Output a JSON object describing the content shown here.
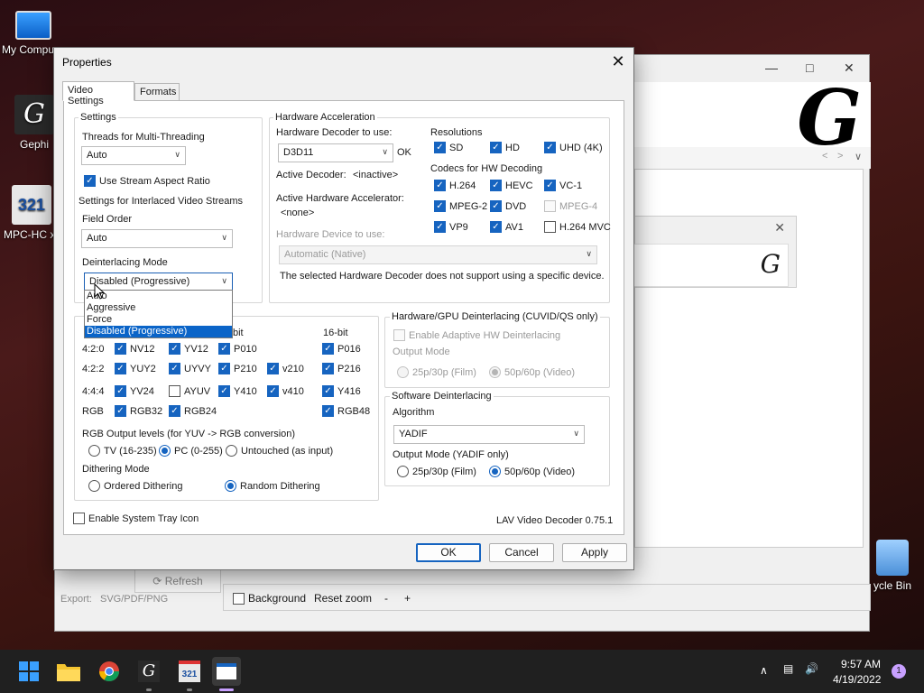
{
  "desktop": {
    "icons": [
      {
        "label": "My Compu"
      },
      {
        "label": "Gephi"
      },
      {
        "label": "MPC-HC x"
      },
      {
        "label": "ycle Bin"
      }
    ]
  },
  "gephi": {
    "refresh_label": "Refresh",
    "export_label": "Export:",
    "export_formats": "SVG/PDF/PNG",
    "background_label": "Background",
    "reset_zoom_label": "Reset zoom",
    "minus": "-",
    "plus": "+"
  },
  "dialog": {
    "title": "Properties",
    "tabs": [
      {
        "label": "Video Settings",
        "active": true
      },
      {
        "label": "Formats",
        "active": false
      }
    ],
    "settings": {
      "group_title": "Settings",
      "threads_label": "Threads for Multi-Threading",
      "threads_value": "Auto",
      "stream_aspect_label": "Use Stream Aspect Ratio",
      "stream_aspect_checked": true,
      "interlaced_label": "Settings for Interlaced Video Streams",
      "field_order_label": "Field Order",
      "field_order_value": "Auto",
      "deint_mode_label": "Deinterlacing Mode",
      "deint_mode_value": "Disabled (Progressive)",
      "deint_options": [
        "Auto",
        "Aggressive",
        "Force",
        "Disabled (Progressive)"
      ]
    },
    "hwaccel": {
      "group_title": "Hardware Acceleration",
      "decoder_label": "Hardware Decoder to use:",
      "decoder_value": "D3D11",
      "decoder_status": "OK",
      "active_decoder_label": "Active Decoder:",
      "active_decoder_value": "<inactive>",
      "active_accel_label": "Active Hardware Accelerator:",
      "active_accel_value": "<none>",
      "device_label": "Hardware Device to use:",
      "device_value": "Automatic (Native)",
      "device_note": "The selected Hardware Decoder does not support using a specific device.",
      "resolutions_label": "Resolutions",
      "resolutions": [
        {
          "label": "SD",
          "checked": true,
          "enabled": true
        },
        {
          "label": "HD",
          "checked": true,
          "enabled": true
        },
        {
          "label": "UHD (4K)",
          "checked": true,
          "enabled": true
        }
      ],
      "codecs_label": "Codecs for HW Decoding",
      "codecs": [
        {
          "label": "H.264",
          "checked": true,
          "enabled": true
        },
        {
          "label": "HEVC",
          "checked": true,
          "enabled": true
        },
        {
          "label": "VC-1",
          "checked": true,
          "enabled": true
        },
        {
          "label": "MPEG-2",
          "checked": true,
          "enabled": true
        },
        {
          "label": "DVD",
          "checked": true,
          "enabled": true
        },
        {
          "label": "MPEG-4",
          "checked": false,
          "enabled": false
        },
        {
          "label": "VP9",
          "checked": true,
          "enabled": true
        },
        {
          "label": "AV1",
          "checked": true,
          "enabled": true
        },
        {
          "label": "H.264 MVC",
          "checked": false,
          "enabled": true
        }
      ]
    },
    "formats": {
      "col_headers": [
        "bit",
        "16-bit"
      ],
      "rows": [
        {
          "label": "4:2:0",
          "items": [
            {
              "label": "NV12",
              "checked": true
            },
            {
              "label": "YV12",
              "checked": true
            },
            {
              "label": "P010",
              "checked": true
            },
            {
              "label": "P016",
              "checked": true
            }
          ]
        },
        {
          "label": "4:2:2",
          "items": [
            {
              "label": "YUY2",
              "checked": true
            },
            {
              "label": "UYVY",
              "checked": true
            },
            {
              "label": "P210",
              "checked": true
            },
            {
              "label": "v210",
              "checked": true
            },
            {
              "label": "P216",
              "checked": true
            }
          ]
        },
        {
          "label": "4:4:4",
          "items": [
            {
              "label": "YV24",
              "checked": true
            },
            {
              "label": "AYUV",
              "checked": false
            },
            {
              "label": "Y410",
              "checked": true
            },
            {
              "label": "v410",
              "checked": true
            },
            {
              "label": "Y416",
              "checked": true
            }
          ]
        },
        {
          "label": "RGB",
          "items": [
            {
              "label": "RGB32",
              "checked": true
            },
            {
              "label": "RGB24",
              "checked": true
            },
            {
              "label": "RGB48",
              "checked": true
            }
          ]
        }
      ],
      "rgb_levels_label": "RGB Output levels (for YUV -> RGB conversion)",
      "rgb_levels": [
        {
          "label": "TV (16-235)",
          "selected": false
        },
        {
          "label": "PC (0-255)",
          "selected": true
        },
        {
          "label": "Untouched (as input)",
          "selected": false
        }
      ],
      "dither_label": "Dithering Mode",
      "dither": [
        {
          "label": "Ordered Dithering",
          "selected": false
        },
        {
          "label": "Random Dithering",
          "selected": true
        }
      ]
    },
    "hwdeint": {
      "group_title": "Hardware/GPU Deinterlacing (CUVID/QS only)",
      "adaptive_label": "Enable Adaptive HW Deinterlacing",
      "output_mode_label": "Output Mode",
      "modes": [
        {
          "label": "25p/30p (Film)",
          "selected": false
        },
        {
          "label": "50p/60p (Video)",
          "selected": true
        }
      ]
    },
    "swdeint": {
      "group_title": "Software Deinterlacing",
      "algorithm_label": "Algorithm",
      "algorithm_value": "YADIF",
      "output_mode_label": "Output Mode (YADIF only)",
      "modes": [
        {
          "label": "25p/30p (Film)",
          "selected": false
        },
        {
          "label": "50p/60p (Video)",
          "selected": true
        }
      ]
    },
    "tray_icon_label": "Enable System Tray Icon",
    "version": "LAV Video Decoder 0.75.1",
    "buttons": {
      "ok": "OK",
      "cancel": "Cancel",
      "apply": "Apply"
    }
  },
  "taskbar": {
    "time": "9:57 AM",
    "date": "4/19/2022",
    "notification_count": "1"
  }
}
